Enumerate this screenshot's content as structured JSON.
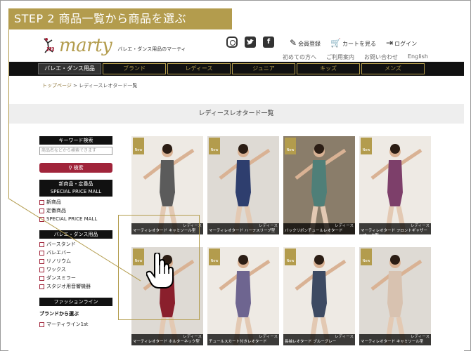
{
  "step": {
    "label": "STEP 2  商品一覧から商品を選ぶ"
  },
  "header": {
    "logo": "marty",
    "logo_mark_letter": "m",
    "tagline": "バレエ・ダンス用品のマーティ",
    "social": [
      "instagram-icon",
      "twitter-icon",
      "facebook-icon"
    ],
    "facebook_glyph": "f",
    "links": [
      {
        "icon": "pen-icon",
        "label": "会員登録"
      },
      {
        "icon": "cart-icon",
        "label": "カートを見る"
      },
      {
        "icon": "login-icon",
        "label": "ログイン"
      }
    ],
    "sub_links": [
      "初めての方へ",
      "ご利用案内",
      "お問い合わせ",
      "English"
    ]
  },
  "nav": [
    "バレエ・ダンス用品",
    "ブランド",
    "レディース",
    "ジュニア",
    "キッズ",
    "メンズ"
  ],
  "breadcrumb": {
    "home": "トップページ",
    "sep": " > ",
    "current": "レディースレオタード一覧"
  },
  "page_title": "レディースレオタード一覧",
  "sidebar": {
    "keyword_head": "キーワード検索",
    "search_placeholder": "商品名などから検索できます",
    "search_button": "検索",
    "new_head_1": "新商品・定番品",
    "new_head_2": "SPECIAL PRICE MALL",
    "new_items": [
      "新商品",
      "定番商品",
      "SPECIAL PRICE MALL"
    ],
    "ballet_head": "バレエ・ダンス用品",
    "ballet_items": [
      "バースタンド",
      "バレエバー",
      "リノリウム",
      "ワックス",
      "ダンスミラー",
      "スタジオ用音響機器"
    ],
    "fashion_head": "ファッションライン",
    "brand_label": "ブランドから選ぶ",
    "brand_items": [
      "マーティライン1st"
    ]
  },
  "products": [
    {
      "badge": "New",
      "category": "レディース",
      "name": "マーティレオタード キャミソール型",
      "color": "#5b5b5b"
    },
    {
      "badge": "New",
      "category": "レディース",
      "name": "マーティレオタード ハーフスリーブ型",
      "color": "#2e3e6e"
    },
    {
      "badge": "New",
      "category": "レディース",
      "name": "バックリボンチュールレオタード",
      "color": "#4f7f78"
    },
    {
      "badge": "New",
      "category": "レディース",
      "name": "マーティレオタード フロントギャザーVネック型",
      "color": "#7d3f6a"
    },
    {
      "badge": "New",
      "category": "レディース",
      "name": "マーティレオタード ホルターネック型",
      "color": "#8a1f2c"
    },
    {
      "badge": "New",
      "category": "レディース",
      "name": "チュールスカート付きレオタード",
      "color": "#6e6590"
    },
    {
      "badge": "New",
      "category": "レディース",
      "name": "長袖レオタード ブルーグレー",
      "color": "#3d4a62"
    },
    {
      "badge": "New",
      "category": "レディース",
      "name": "マーティレオタード キャミソール型",
      "color": "#d8c2b0"
    }
  ]
}
